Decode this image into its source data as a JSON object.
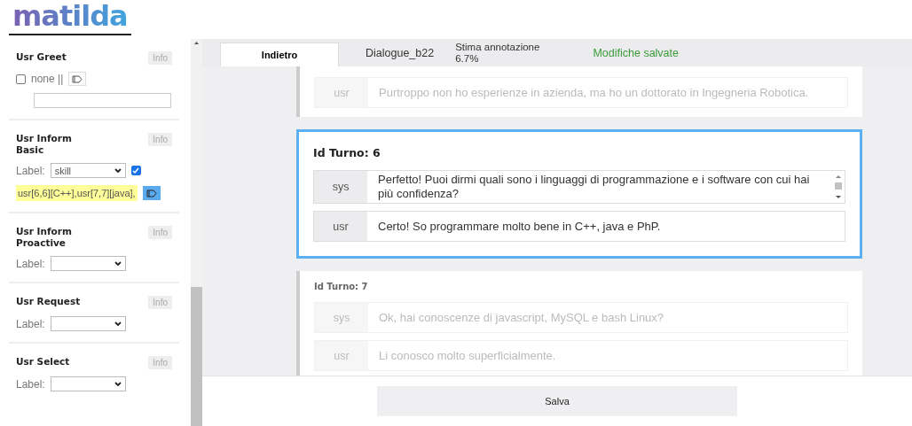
{
  "logo": "matilda",
  "sidebar": {
    "sections": [
      {
        "kind": "option",
        "title": "Usr Greet",
        "info": "Info",
        "checked": false,
        "option": "none ||"
      },
      {
        "kind": "label",
        "title": "Usr Inform Basic",
        "info": "Info",
        "label": "Label:",
        "value": "skill",
        "checked": true,
        "annotation": "usr[6,6][C++],usr[7,7][java],"
      },
      {
        "kind": "label",
        "title": "Usr Inform Proactive",
        "info": "Info",
        "label": "Label:"
      },
      {
        "kind": "label",
        "title": "Usr Request",
        "info": "Info",
        "label": "Label:"
      },
      {
        "kind": "label",
        "title": "Usr Select",
        "info": "Info",
        "label": "Label:"
      }
    ]
  },
  "header": {
    "back": "Indietro",
    "dialogue": "Dialogue_b22",
    "estimate_label": "Stima annotazione",
    "estimate": "6.7%",
    "status": "Modifiche salvate"
  },
  "turns": [
    {
      "selected": false,
      "rows": [
        {
          "speaker": "usr",
          "text": "Purtroppo non ho esperienze in azienda, ma ho un dottorato in Ingegneria Robotica."
        }
      ]
    },
    {
      "selected": true,
      "title": "Id Turno: 6",
      "rows": [
        {
          "speaker": "sys",
          "text": "Perfetto! Puoi dirmi quali sono i linguaggi di programmazione e i software con cui hai più confidenza?"
        },
        {
          "speaker": "usr",
          "text": "Certo! So programmare molto bene in C++, java e PhP."
        }
      ]
    },
    {
      "selected": false,
      "title": "Id Turno: 7",
      "rows": [
        {
          "speaker": "sys",
          "text": "Ok, hai conoscenze di javascript, MySQL e bash Linux?"
        },
        {
          "speaker": "usr",
          "text": "Li conosco molto superficialmente."
        }
      ]
    }
  ],
  "footer": {
    "save": "Salva"
  }
}
